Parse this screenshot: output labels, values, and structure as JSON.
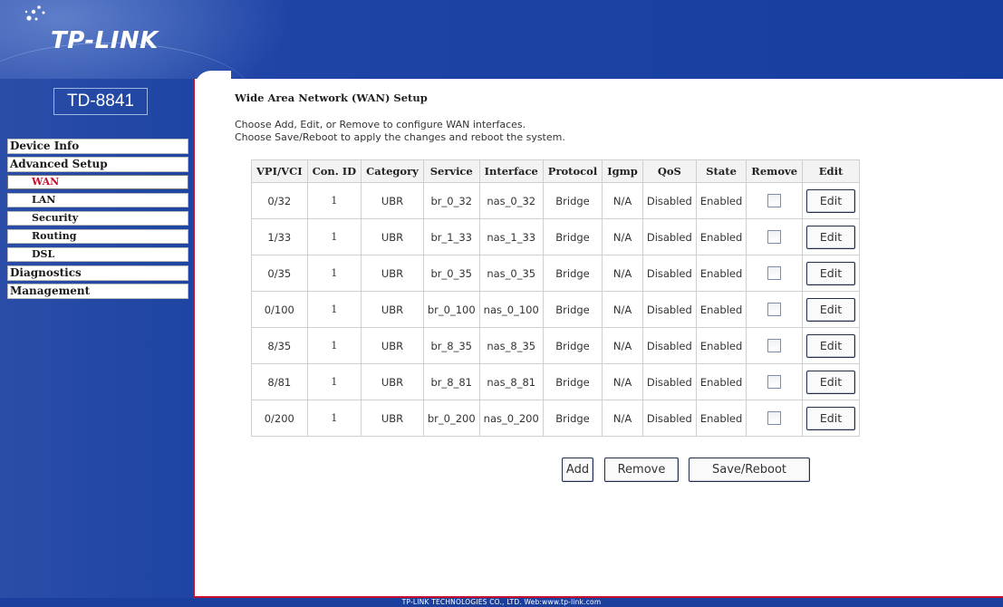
{
  "brand": {
    "logo": "TP-LINK",
    "model": "TD-8841"
  },
  "sidebar": {
    "items": [
      {
        "label": "Device Info",
        "type": "main"
      },
      {
        "label": "Advanced Setup",
        "type": "main"
      },
      {
        "label": "WAN",
        "type": "sub",
        "active": true
      },
      {
        "label": "LAN",
        "type": "sub"
      },
      {
        "label": "Security",
        "type": "sub"
      },
      {
        "label": "Routing",
        "type": "sub"
      },
      {
        "label": "DSL",
        "type": "sub"
      },
      {
        "label": "Diagnostics",
        "type": "main"
      },
      {
        "label": "Management",
        "type": "main"
      }
    ]
  },
  "page": {
    "title": "Wide Area Network (WAN) Setup",
    "desc_line1": "Choose Add, Edit, or Remove to configure WAN interfaces.",
    "desc_line2": "Choose Save/Reboot to apply the changes and reboot the system."
  },
  "table": {
    "headers": [
      "VPI/VCI",
      "Con. ID",
      "Category",
      "Service",
      "Interface",
      "Protocol",
      "Igmp",
      "QoS",
      "State",
      "Remove",
      "Edit"
    ],
    "rows": [
      {
        "vpivci": "0/32",
        "conid": "1",
        "category": "UBR",
        "service": "br_0_32",
        "interface": "nas_0_32",
        "protocol": "Bridge",
        "igmp": "N/A",
        "qos": "Disabled",
        "state": "Enabled",
        "edit": "Edit"
      },
      {
        "vpivci": "1/33",
        "conid": "1",
        "category": "UBR",
        "service": "br_1_33",
        "interface": "nas_1_33",
        "protocol": "Bridge",
        "igmp": "N/A",
        "qos": "Disabled",
        "state": "Enabled",
        "edit": "Edit"
      },
      {
        "vpivci": "0/35",
        "conid": "1",
        "category": "UBR",
        "service": "br_0_35",
        "interface": "nas_0_35",
        "protocol": "Bridge",
        "igmp": "N/A",
        "qos": "Disabled",
        "state": "Enabled",
        "edit": "Edit"
      },
      {
        "vpivci": "0/100",
        "conid": "1",
        "category": "UBR",
        "service": "br_0_100",
        "interface": "nas_0_100",
        "protocol": "Bridge",
        "igmp": "N/A",
        "qos": "Disabled",
        "state": "Enabled",
        "edit": "Edit"
      },
      {
        "vpivci": "8/35",
        "conid": "1",
        "category": "UBR",
        "service": "br_8_35",
        "interface": "nas_8_35",
        "protocol": "Bridge",
        "igmp": "N/A",
        "qos": "Disabled",
        "state": "Enabled",
        "edit": "Edit"
      },
      {
        "vpivci": "8/81",
        "conid": "1",
        "category": "UBR",
        "service": "br_8_81",
        "interface": "nas_8_81",
        "protocol": "Bridge",
        "igmp": "N/A",
        "qos": "Disabled",
        "state": "Enabled",
        "edit": "Edit"
      },
      {
        "vpivci": "0/200",
        "conid": "1",
        "category": "UBR",
        "service": "br_0_200",
        "interface": "nas_0_200",
        "protocol": "Bridge",
        "igmp": "N/A",
        "qos": "Disabled",
        "state": "Enabled",
        "edit": "Edit"
      }
    ]
  },
  "buttons": {
    "add": "Add",
    "remove": "Remove",
    "save_reboot": "Save/Reboot"
  },
  "footer": {
    "text": "TP-LINK TECHNOLOGIES CO., LTD. Web:www.tp-link.com"
  },
  "colors": {
    "banner_blue": "#1e44a6",
    "accent_red": "#c8102e"
  }
}
